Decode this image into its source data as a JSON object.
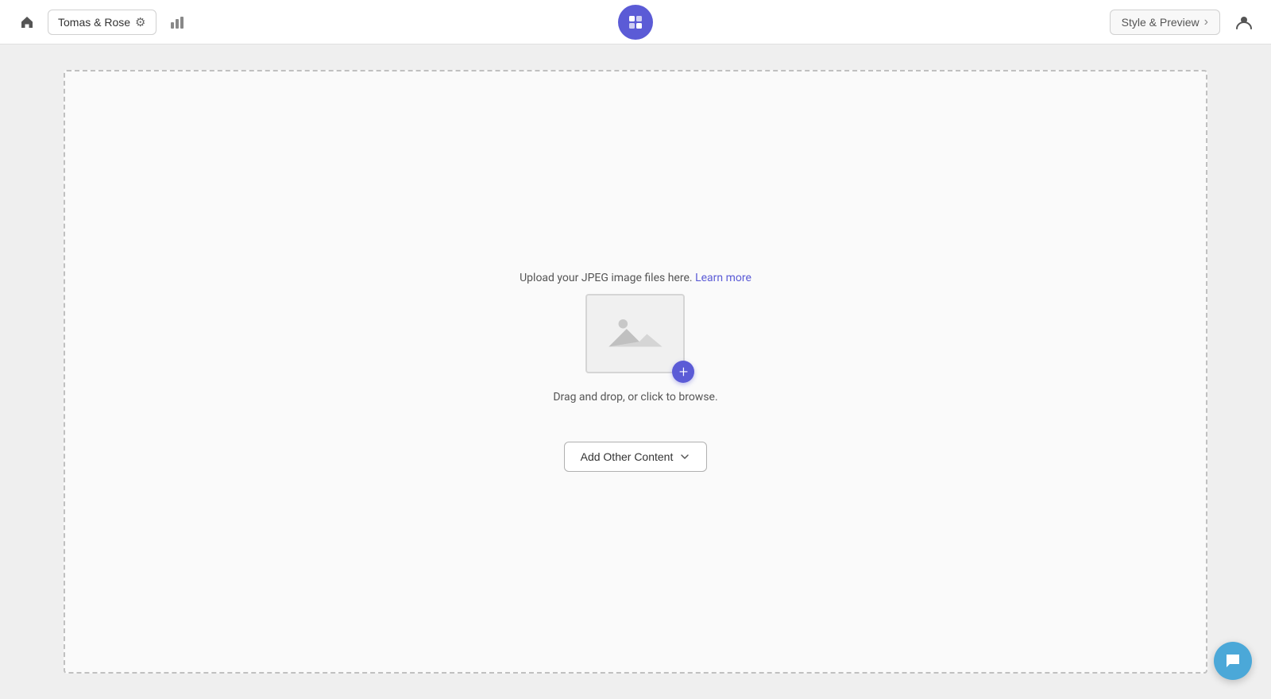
{
  "header": {
    "workspace_label": "Tomas & Rose",
    "style_preview_label": "Style & Preview",
    "gear_icon": "⚙",
    "chevron_right": "›"
  },
  "upload": {
    "instruction_text": "Upload your JPEG image files here.",
    "learn_more_text": "Learn more",
    "drag_drop_text": "Drag and drop, or click to browse.",
    "learn_more_url": "#"
  },
  "buttons": {
    "add_other_content": "Add Other Content"
  },
  "colors": {
    "brand_purple": "#5b5bd6",
    "chat_blue": "#4ba8d8"
  }
}
